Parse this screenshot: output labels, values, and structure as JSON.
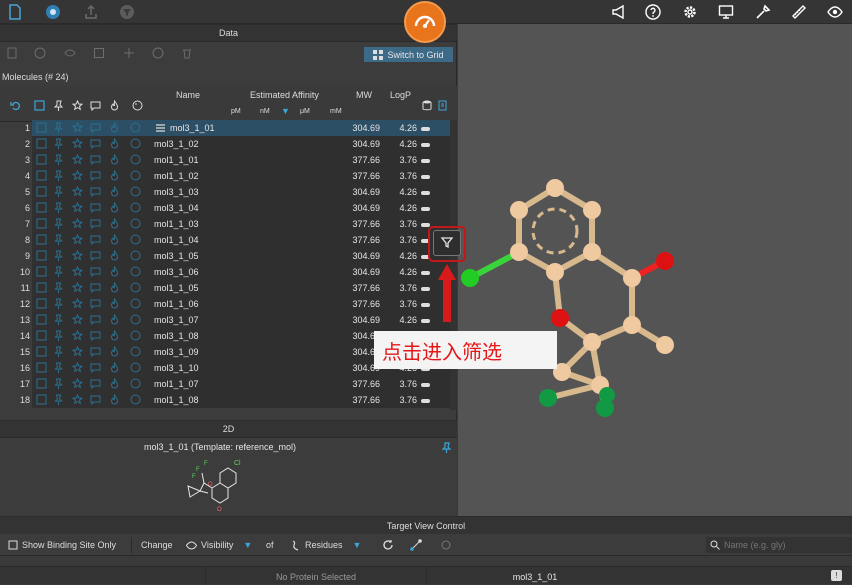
{
  "toolbar": {
    "left_icons": [
      "file-icon",
      "app-icon",
      "export-icon",
      "filter-icon"
    ],
    "right_icons": [
      "announcement-icon",
      "help-icon",
      "settings-icon",
      "monitor-icon",
      "tools-icon",
      "measure-icon",
      "view-icon"
    ],
    "badge_icon": "speedometer-icon",
    "accent": "#e8741c"
  },
  "data_panel": {
    "title": "Data",
    "switch_label": "Switch to Grid",
    "molecule_count": "Molecules (# 24)"
  },
  "table": {
    "headers": {
      "name": "Name",
      "affinity": "Estimated Affinity",
      "mw": "MW",
      "logp": "LogP"
    },
    "affinity_units": [
      "pM",
      "nM",
      "μM",
      "mM"
    ],
    "rows": [
      {
        "num": "1",
        "name": "mol3_1_01",
        "mw": "304.69",
        "logp": "4.26"
      },
      {
        "num": "2",
        "name": "mol3_1_02",
        "mw": "304.69",
        "logp": "4.26"
      },
      {
        "num": "3",
        "name": "mol1_1_01",
        "mw": "377.66",
        "logp": "3.76"
      },
      {
        "num": "4",
        "name": "mol1_1_02",
        "mw": "377.66",
        "logp": "3.76"
      },
      {
        "num": "5",
        "name": "mol3_1_03",
        "mw": "304.69",
        "logp": "4.26"
      },
      {
        "num": "6",
        "name": "mol3_1_04",
        "mw": "304.69",
        "logp": "4.26"
      },
      {
        "num": "7",
        "name": "mol1_1_03",
        "mw": "377.66",
        "logp": "3.76"
      },
      {
        "num": "8",
        "name": "mol1_1_04",
        "mw": "377.66",
        "logp": "3.76"
      },
      {
        "num": "9",
        "name": "mol3_1_05",
        "mw": "304.69",
        "logp": "4.26"
      },
      {
        "num": "10",
        "name": "mol3_1_06",
        "mw": "304.69",
        "logp": "4.26"
      },
      {
        "num": "11",
        "name": "mol1_1_05",
        "mw": "377.66",
        "logp": "3.76"
      },
      {
        "num": "12",
        "name": "mol1_1_06",
        "mw": "377.66",
        "logp": "3.76"
      },
      {
        "num": "13",
        "name": "mol3_1_07",
        "mw": "304.69",
        "logp": "4.26"
      },
      {
        "num": "14",
        "name": "mol3_1_08",
        "mw": "304.69",
        "logp": "4.26"
      },
      {
        "num": "15",
        "name": "mol3_1_09",
        "mw": "304.69",
        "logp": "4.26"
      },
      {
        "num": "16",
        "name": "mol3_1_10",
        "mw": "304.69",
        "logp": "4.26"
      },
      {
        "num": "17",
        "name": "mol1_1_07",
        "mw": "377.66",
        "logp": "3.76"
      },
      {
        "num": "18",
        "name": "mol1_1_08",
        "mw": "377.66",
        "logp": "3.76"
      }
    ]
  },
  "twod": {
    "title": "2D",
    "caption": "mol3_1_01 (Template: reference_mol)",
    "atom_labels": [
      "Cl",
      "F",
      "F",
      "F",
      "O",
      "O"
    ]
  },
  "callout": {
    "text": "点击进入筛选",
    "color": "#e31818"
  },
  "target_view": {
    "title": "Target View Control",
    "binding_label": "Show Binding Site Only",
    "change_label": "Change",
    "visibility_label": "Visibility",
    "of_label": "of",
    "residues_label": "Residues",
    "search_placeholder": "Name (e.g. gly)"
  },
  "status": {
    "protein": "No Protein Selected",
    "ligand": "mol3_1_01"
  }
}
